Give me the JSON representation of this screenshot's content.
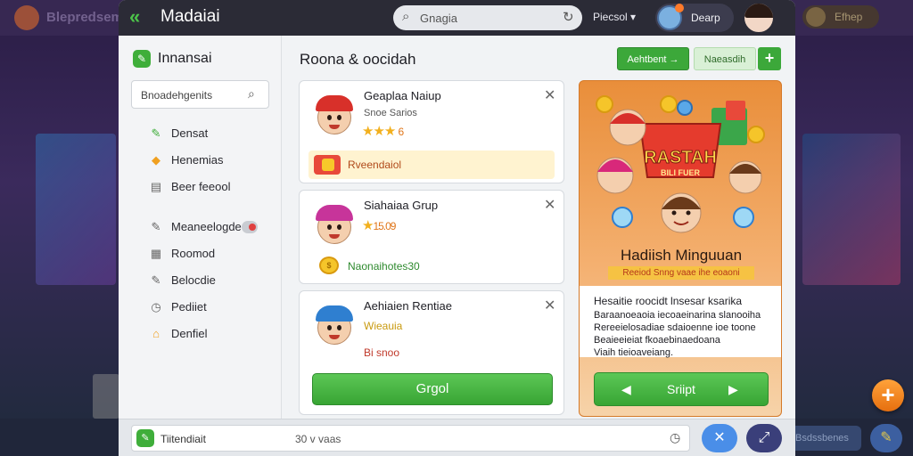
{
  "background": {
    "topbar_text": "Blepredsemi",
    "chip_text": "Efhep",
    "bottom_chip_text": "Bsdssbenes"
  },
  "titlebar": {
    "title": "Madaiai",
    "search_text": "Gnagia",
    "menu_label": "Piecsol",
    "menu_chevron": "▾",
    "user_name": "Dearp"
  },
  "sidebar": {
    "header": "Innansai",
    "search_placeholder": "Bnoadehgenits",
    "items": [
      {
        "label": "Densat",
        "icon": "wrench-icon",
        "glyph": "✎",
        "color": "#3fae3a"
      },
      {
        "label": "Henemias",
        "icon": "tag-icon",
        "glyph": "◆",
        "color": "#f0a020"
      },
      {
        "label": "Beer feeool",
        "icon": "folder-icon",
        "glyph": "▤",
        "color": "#666666"
      },
      {
        "label": "Meaneelogde",
        "icon": "tools-icon",
        "glyph": "✎",
        "color": "#666666"
      },
      {
        "label": "Roomod",
        "icon": "calendar-icon",
        "glyph": "▦",
        "color": "#666666"
      },
      {
        "label": "Belocdie",
        "icon": "pencil-icon",
        "glyph": "✎",
        "color": "#666666"
      },
      {
        "label": "Pediiet",
        "icon": "clock-icon",
        "glyph": "◷",
        "color": "#666666"
      },
      {
        "label": "Denfiel",
        "icon": "house-icon",
        "glyph": "⌂",
        "color": "#f0a020"
      }
    ]
  },
  "main": {
    "title": "Roona & oocidah",
    "primary_button": "Aehtbent →",
    "secondary_button": "Naeasdih",
    "plus_label": "+"
  },
  "cards": [
    {
      "name": "Geaplaa Naiup",
      "sub": "Snoe Sarios",
      "rating": "★★★",
      "rating_value": "6",
      "promo": "Rveendaiol"
    },
    {
      "name": "Siahaiaa Grup",
      "rating": "★",
      "rating_value": "15.09",
      "coin_text": "Naonaihotes30"
    },
    {
      "name": "Aehiaien Rentiae",
      "line1": "Wieauia",
      "line2": "Bi snoo",
      "button": "Grgol"
    }
  ],
  "banner": {
    "art_title": "RASTAH",
    "art_sub": "BILI FUER",
    "title": "Hadiish Minguuan",
    "tagline": "Reeiod Snng vaae ihe eoaoni",
    "desc": [
      "Hesaitie roocidt lnsesar ksarika",
      "Baraanoeaoia iecoaeinarina slanooiha",
      "Rereeielosadiae sdaioenne ioe toone",
      "Beaieeieiat fkoaebinaedoana",
      "Viaih tieioaveiang."
    ],
    "button": "Sriipt"
  },
  "bottombar": {
    "input_text": "Tiitendiait",
    "count": "30 v vaas"
  },
  "colors": {
    "accent_green": "#3ca83a",
    "titlebar": "#2b2b36",
    "banner_orange": "#e98e3a",
    "fab_orange": "#f08a20"
  }
}
